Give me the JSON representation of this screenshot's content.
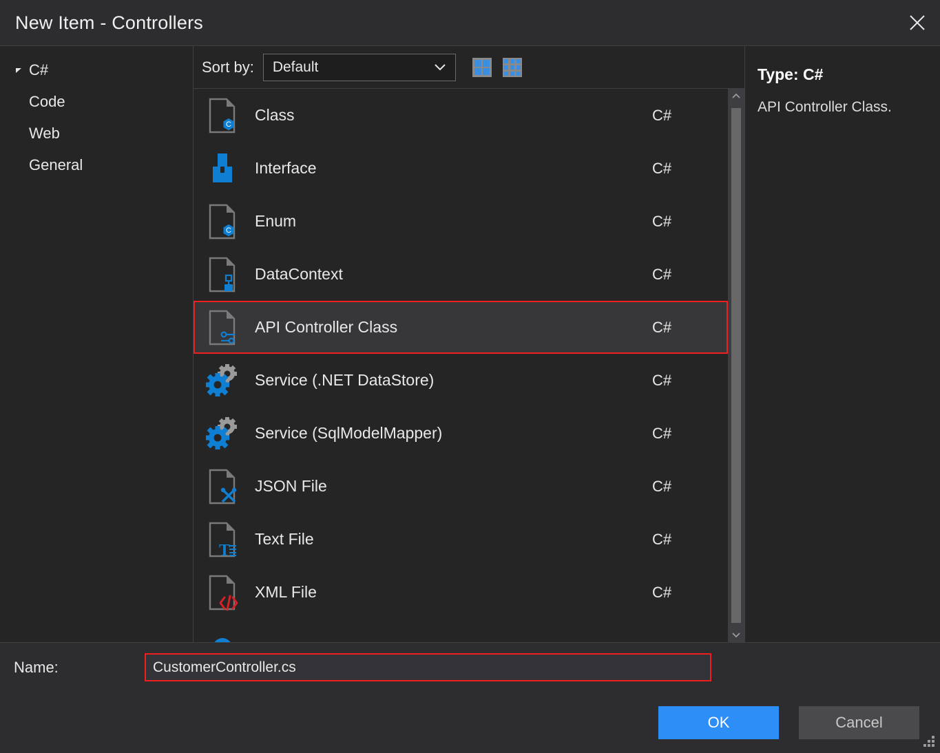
{
  "window": {
    "title": "New Item - Controllers",
    "close_icon": "close-icon"
  },
  "sidebar": {
    "items": [
      {
        "label": "C#",
        "level": 0,
        "expanded": true
      },
      {
        "label": "Code",
        "level": 1
      },
      {
        "label": "Web",
        "level": 1
      },
      {
        "label": "General",
        "level": 1
      }
    ]
  },
  "toolbar": {
    "sort_label": "Sort by:",
    "sort_value": "Default",
    "sort_options": [
      "Default"
    ],
    "view_large_icon": "large-grid-icon",
    "view_small_icon": "small-grid-icon"
  },
  "list": {
    "items": [
      {
        "name": "Class",
        "lang": "C#",
        "icon": "csharp-class-icon",
        "selected": false
      },
      {
        "name": "Interface",
        "lang": "C#",
        "icon": "interface-icon",
        "selected": false
      },
      {
        "name": "Enum",
        "lang": "C#",
        "icon": "csharp-enum-icon",
        "selected": false
      },
      {
        "name": "DataContext",
        "lang": "C#",
        "icon": "datacontext-icon",
        "selected": false
      },
      {
        "name": "API Controller Class",
        "lang": "C#",
        "icon": "api-controller-icon",
        "selected": true
      },
      {
        "name": "Service (.NET DataStore)",
        "lang": "C#",
        "icon": "service-gears-icon",
        "selected": false
      },
      {
        "name": "Service (SqlModelMapper)",
        "lang": "C#",
        "icon": "service-gears-icon",
        "selected": false
      },
      {
        "name": "JSON File",
        "lang": "C#",
        "icon": "json-file-icon",
        "selected": false
      },
      {
        "name": "Text File",
        "lang": "C#",
        "icon": "text-file-icon",
        "selected": false
      },
      {
        "name": "XML File",
        "lang": "C#",
        "icon": "xml-file-icon",
        "selected": false
      }
    ]
  },
  "details": {
    "type_label": "Type: C#",
    "description": "API Controller Class."
  },
  "name_field": {
    "label": "Name:",
    "value": "CustomerController.cs",
    "placeholder": ""
  },
  "footer": {
    "ok_label": "OK",
    "cancel_label": "Cancel"
  },
  "colors": {
    "accent_blue": "#2e8ef7",
    "highlight_red": "#f01f1f",
    "icon_blue": "#0f7fd4",
    "icon_gray": "#7a7a7a",
    "icon_red": "#d62127",
    "window_bg": "#252526",
    "chrome_bg": "#2d2d30",
    "selected_row_bg": "#37373a"
  }
}
